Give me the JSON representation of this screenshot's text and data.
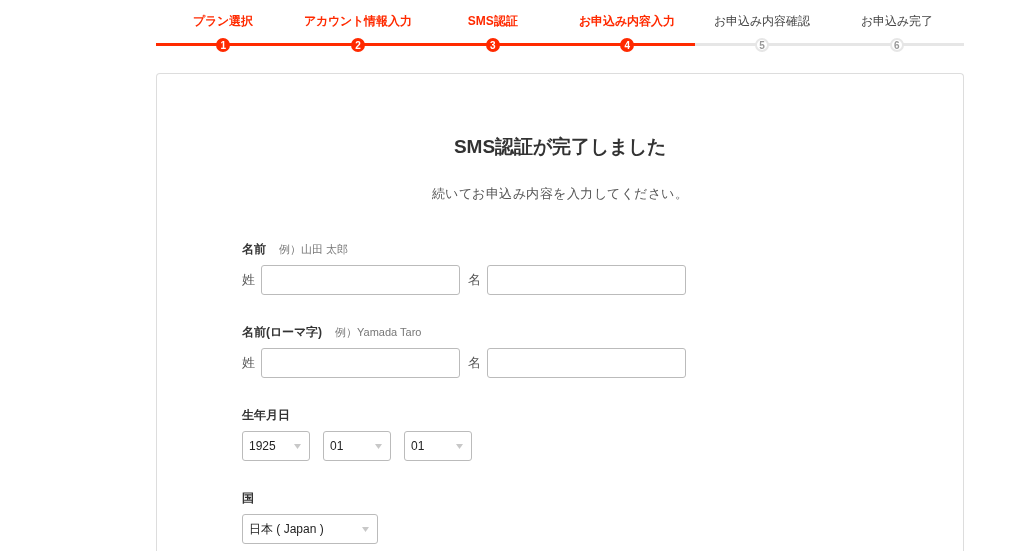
{
  "steps": [
    {
      "label": "プラン選択",
      "number": "1",
      "completed": true
    },
    {
      "label": "アカウント情報入力",
      "number": "2",
      "completed": true
    },
    {
      "label": "SMS認証",
      "number": "3",
      "completed": true
    },
    {
      "label": "お申込み内容入力",
      "number": "4",
      "completed": true
    },
    {
      "label": "お申込み内容確認",
      "number": "5",
      "completed": false
    },
    {
      "label": "お申込み完了",
      "number": "6",
      "completed": false
    }
  ],
  "card": {
    "title": "SMS認証が完了しました",
    "subtitle": "続いてお申込み内容を入力してください。",
    "sections": [
      {
        "kind": "name",
        "label": "名前",
        "hint": "例）山田 太郎",
        "fields": [
          {
            "label": "姓"
          },
          {
            "label": "名"
          }
        ]
      },
      {
        "kind": "name",
        "label": "名前(ローマ字)",
        "hint": "例）Yamada Taro",
        "fields": [
          {
            "label": "姓"
          },
          {
            "label": "名"
          }
        ]
      },
      {
        "kind": "selects",
        "label": "生年月日",
        "selects": [
          {
            "value": "1925"
          },
          {
            "value": "01"
          },
          {
            "value": "01"
          }
        ]
      },
      {
        "kind": "country",
        "label": "国",
        "selects": [
          {
            "value": "日本 ( Japan )"
          }
        ]
      }
    ]
  }
}
